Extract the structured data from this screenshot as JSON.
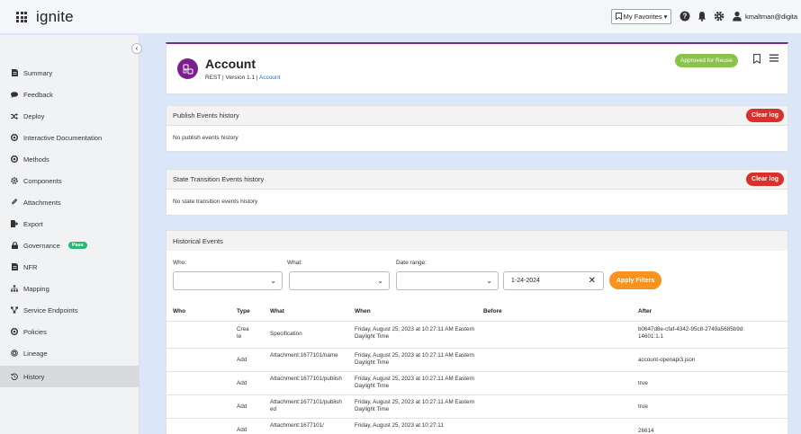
{
  "header": {
    "brand": "ignite",
    "favorites_label": "My Favorites",
    "user": "kmaltman@digita"
  },
  "sidebar": {
    "items": [
      {
        "label": "Summary",
        "icon": "document-icon"
      },
      {
        "label": "Feedback",
        "icon": "chat-icon"
      },
      {
        "label": "Deploy",
        "icon": "shuffle-icon"
      },
      {
        "label": "Interactive Documentation",
        "icon": "circle-icon"
      },
      {
        "label": "Methods",
        "icon": "circle-icon"
      },
      {
        "label": "Components",
        "icon": "gear-icon"
      },
      {
        "label": "Attachments",
        "icon": "paperclip-icon"
      },
      {
        "label": "Export",
        "icon": "export-icon"
      },
      {
        "label": "Governance",
        "icon": "lock-icon",
        "badge": "Pass"
      },
      {
        "label": "NFR",
        "icon": "document-icon"
      },
      {
        "label": "Mapping",
        "icon": "sitemap-icon"
      },
      {
        "label": "Service Endpoints",
        "icon": "endpoints-icon"
      },
      {
        "label": "Policies",
        "icon": "circle-icon"
      },
      {
        "label": "Lineage",
        "icon": "lineage-icon"
      },
      {
        "label": "History",
        "icon": "history-icon"
      }
    ]
  },
  "account": {
    "title": "Account",
    "sub_prefix": "REST | Version 1.1 | ",
    "sub_link": "Account",
    "approved_label": "Approved for Reuse"
  },
  "publish": {
    "title": "Publish Events history",
    "clear_label": "Clear log",
    "empty": "No publish events history"
  },
  "state": {
    "title": "State Transition Events history",
    "clear_label": "Clear log",
    "empty": "No state transition events history"
  },
  "historical": {
    "title": "Historical Events",
    "filters": {
      "who_label": "Who:",
      "what_label": "What:",
      "date_label": "Date range:",
      "date_value": "1-24-2024",
      "apply_label": "Apply Filters"
    },
    "columns": [
      "Who",
      "Type",
      "What",
      "When",
      "Before",
      "After"
    ],
    "rows": [
      {
        "who": "",
        "type": "Create",
        "what": "Specification",
        "when": "Friday, August 25, 2023 at 10:27:11 AM Eastern Daylight Time",
        "before": "",
        "after": "b0647d8e-cfaf-4342-95c8-2749a5685b9d:14601:1.1"
      },
      {
        "who": "",
        "type": "Add",
        "what": "Attachment:1677101/name",
        "when": "Friday, August 25, 2023 at 10:27:11 AM Eastern Daylight Time",
        "before": "",
        "after": "account-openapi3.json"
      },
      {
        "who": "",
        "type": "Add",
        "what": "Attachment:1677101/publish",
        "when": "Friday, August 25, 2023 at 10:27:11 AM Eastern Daylight Time",
        "before": "",
        "after": "true"
      },
      {
        "who": "",
        "type": "Add",
        "what": "Attachment:1677101/published",
        "when": "Friday, August 25, 2023 at 10:27:11 AM Eastern Daylight Time",
        "before": "",
        "after": "true"
      },
      {
        "who": "",
        "type": "Add",
        "what": "Attachment:1677101/",
        "when": "Friday, August 25, 2023 at 10:27:11",
        "before": "",
        "after": "26614"
      }
    ]
  }
}
